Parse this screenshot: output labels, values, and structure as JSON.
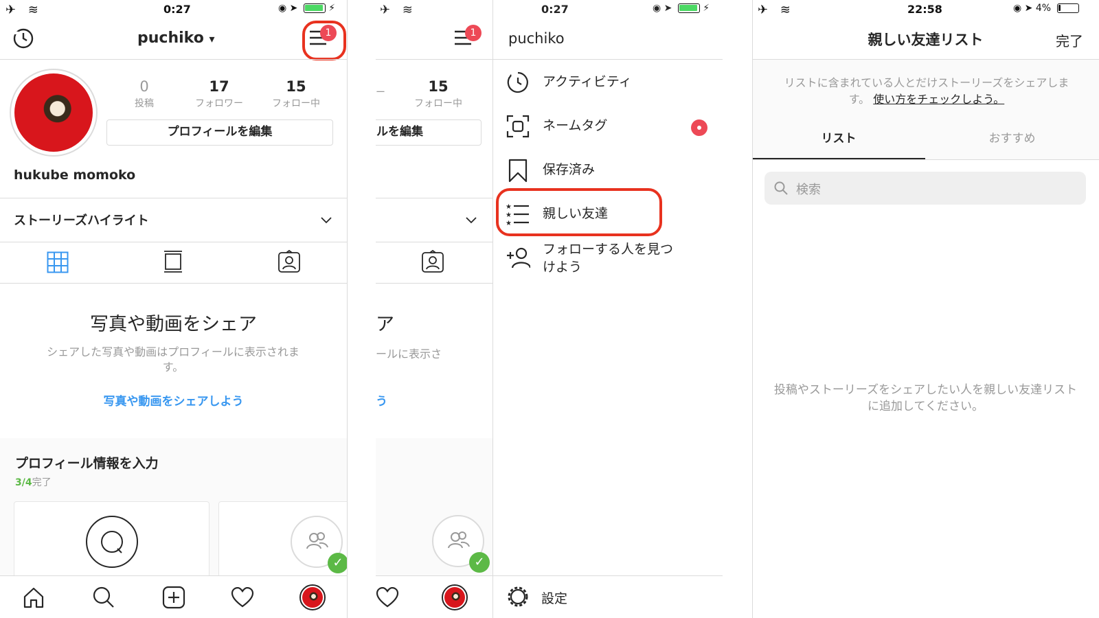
{
  "colors": {
    "accent": "#3897f0",
    "highlight": "#e8321f",
    "badge": "#ed4956",
    "success": "#5cb946",
    "battery_full": "#4cd964"
  },
  "panel1": {
    "status": {
      "time": "0:27"
    },
    "header": {
      "username": "puchiko",
      "chevron": "▾",
      "menu_badge": "1"
    },
    "profile": {
      "posts_count": "0",
      "posts_label": "投稿",
      "followers_count": "17",
      "followers_label": "フォロワー",
      "following_count": "15",
      "following_label": "フォロー中",
      "edit_label": "プロフィールを編集",
      "display_name": "hukube momoko"
    },
    "highlights_label": "ストーリーズハイライト",
    "empty": {
      "title": "写真や動画をシェア",
      "body": "シェアした写真や動画はプロフィールに表示されます。",
      "link": "写真や動画をシェアしよう"
    },
    "complete": {
      "title": "プロフィール情報を入力",
      "progress_done": "3/4",
      "progress_suffix": "完了"
    }
  },
  "panel2": {
    "status": {
      "time": "0:27"
    },
    "menu_badge": "1",
    "behind": {
      "following_count": "15",
      "following_label": "フォロー中",
      "partial_a": "ー",
      "edit_partial": "ルを編集",
      "share_partial": "ア",
      "body_partial": "ールに表示さ",
      "link_partial": "う"
    },
    "drawer": {
      "username": "puchiko",
      "items": [
        {
          "label": "アクティビティ",
          "icon": "activity-icon"
        },
        {
          "label": "ネームタグ",
          "icon": "nametag-icon"
        },
        {
          "label": "保存済み",
          "icon": "bookmark-icon"
        },
        {
          "label": "親しい友達",
          "icon": "close-friends-icon"
        },
        {
          "label": "フォローする人を見つけよう",
          "icon": "add-person-icon"
        }
      ],
      "settings_label": "設定"
    }
  },
  "panel3": {
    "status": {
      "time": "22:58",
      "battery": "4%"
    },
    "header": {
      "title": "親しい友達リスト",
      "done_label": "完了"
    },
    "info_text": "リストに含まれている人とだけストーリーズをシェアします。",
    "info_link": "使い方をチェックしよう。",
    "tabs": [
      {
        "label": "リスト"
      },
      {
        "label": "おすすめ"
      }
    ],
    "search": {
      "placeholder": "検索"
    },
    "empty_text": "投稿やストーリーズをシェアしたい人を親しい友達リストに追加してください。"
  }
}
